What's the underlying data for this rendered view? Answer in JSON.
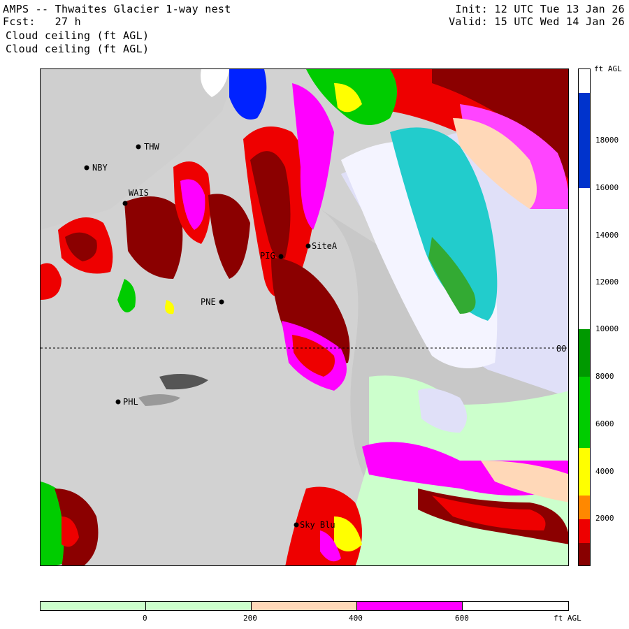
{
  "header": {
    "title": "AMPS -- Thwaites Glacier 1-way nest",
    "forecast": "Fcst:   27 h",
    "field_line1": "Cloud ceiling (ft AGL)",
    "field_line2": "Cloud ceiling (ft AGL)",
    "init": "Init: 12 UTC Tue 13 Jan 26",
    "valid": "Valid: 15 UTC Wed 14 Jan 26"
  },
  "map": {
    "latitude_label": "80 N",
    "stations": [
      {
        "name": "THW"
      },
      {
        "name": "NBY"
      },
      {
        "name": "WAIS"
      },
      {
        "name": "PIG"
      },
      {
        "name": "SiteA"
      },
      {
        "name": "PNE"
      },
      {
        "name": "PHL"
      },
      {
        "name": "Sky Blu"
      }
    ]
  },
  "colorbar_vertical": {
    "unit": "ft AGL",
    "tick_labels": [
      "18000",
      "16000",
      "14000",
      "12000",
      "10000",
      "8000",
      "6000",
      "4000",
      "2000"
    ],
    "colors": [
      "#ffffff",
      "#0033cc",
      "#ffffff",
      "#ffffff",
      "#ffffff",
      "#00aa00",
      "#00cc00",
      "#ffff00",
      "#ff8800",
      "#ee0000",
      "#880000"
    ]
  },
  "colorbar_horizontal": {
    "unit": "ft AGL",
    "tick_labels": [
      "0",
      "200",
      "400",
      "600"
    ],
    "colors": [
      "#ccffcc",
      "#ccffcc",
      "#ffd8b8",
      "#ff00ff",
      "#ffffff"
    ]
  }
}
